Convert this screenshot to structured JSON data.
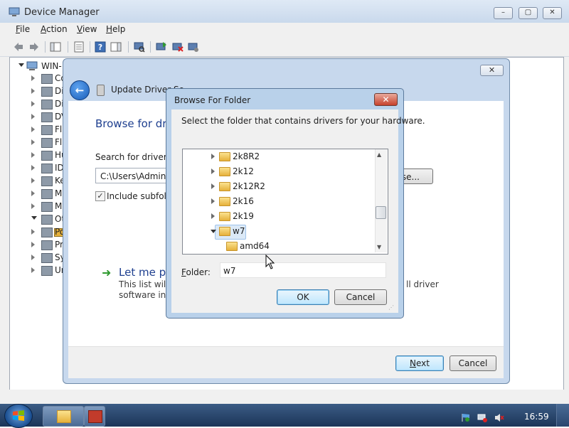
{
  "device_manager": {
    "title": "Device Manager",
    "menu": {
      "file_u": "F",
      "file_rest": "ile",
      "action_u": "A",
      "action_rest": "ction",
      "view_u": "V",
      "view_rest": "iew",
      "help_u": "H",
      "help_rest": "elp"
    },
    "tree": {
      "root_label": "WIN-",
      "items": [
        "Co",
        "Di",
        "Di",
        "DV",
        "Fl",
        "Fl",
        "Hu",
        "ID",
        "Ke",
        "M",
        "M",
        "Ot",
        "Po",
        "Pr",
        "Sy",
        "Ur"
      ]
    }
  },
  "update_driver": {
    "title": "Update Driver So...",
    "heading": "Browse for dri",
    "search_label": "Search for driver so",
    "path_value": "C:\\Users\\Adminis",
    "browse_label": "se...",
    "include_subfolders": "Include subfold",
    "include_subfolders_checked": true,
    "let_me_pick": "Let me pi",
    "let_me_desc_1": "This list will",
    "let_me_desc_2": "software in t",
    "right_desc_1": "ll driver",
    "next_label_u": "N",
    "next_label_rest": "ext",
    "cancel_label": "Cancel",
    "close_glyph": "✕"
  },
  "browse_folder": {
    "title": "Browse For Folder",
    "close_glyph": "✕",
    "instruction": "Select the folder that contains drivers for your hardware.",
    "tree_items": [
      {
        "label": "2k8R2",
        "expanded": false,
        "selected": false
      },
      {
        "label": "2k12",
        "expanded": false,
        "selected": false
      },
      {
        "label": "2k12R2",
        "expanded": false,
        "selected": false
      },
      {
        "label": "2k16",
        "expanded": false,
        "selected": false
      },
      {
        "label": "2k19",
        "expanded": false,
        "selected": false
      },
      {
        "label": "w7",
        "expanded": true,
        "selected": true
      },
      {
        "label": "amd64",
        "expanded": false,
        "selected": false
      }
    ],
    "folder_label_u": "F",
    "folder_label_rest": "older:",
    "folder_value": "w7",
    "ok_label": "OK",
    "cancel_label": "Cancel"
  },
  "taskbar": {
    "time": "16:59"
  },
  "colors": {
    "accent_blue": "#1e3f8f",
    "taskbar": "#2a466e",
    "close_red": "#c7412c",
    "folder_yellow": "#e6b13b"
  }
}
